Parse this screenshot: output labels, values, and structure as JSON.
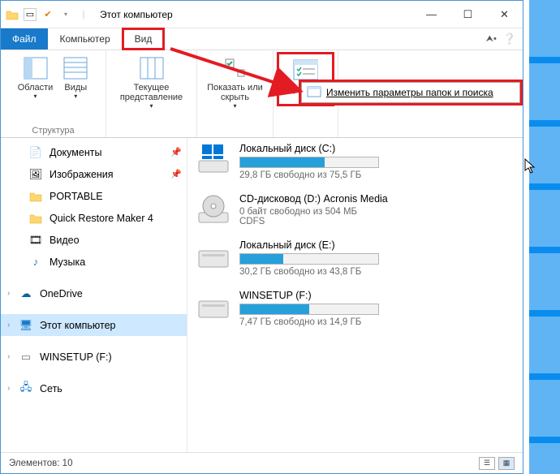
{
  "title": "Этот компьютер",
  "tabs": {
    "file": "Файл",
    "computer": "Компьютер",
    "view": "Вид"
  },
  "ribbon": {
    "panes": "Области",
    "views": "Виды",
    "struct": "Структура",
    "current": "Текущее представление",
    "show_hide": "Показать или скрыть",
    "params": "Параметры"
  },
  "dropdown": {
    "change_opts": "Изменить параметры папок и поиска"
  },
  "nav": {
    "documents": "Документы",
    "images": "Изображения",
    "portable": "PORTABLE",
    "qrm": "Quick Restore Maker 4",
    "video": "Видео",
    "music": "Музыка",
    "onedrive": "OneDrive",
    "thispc": "Этот компьютер",
    "winsetup": "WINSETUP (F:)",
    "network": "Сеть"
  },
  "drives": [
    {
      "name": "Локальный диск (C:)",
      "free": "29,8 ГБ свободно из 75,5 ГБ",
      "pct": 61,
      "type": "hdd"
    },
    {
      "name": "CD-дисковод (D:) Acronis Media",
      "free": "0 байт свободно из 504 МБ",
      "sub": "CDFS",
      "pct": 0,
      "type": "cd"
    },
    {
      "name": "Локальный диск (E:)",
      "free": "30,2 ГБ свободно из 43,8 ГБ",
      "pct": 31,
      "type": "hdd"
    },
    {
      "name": "WINSETUP (F:)",
      "free": "7,47 ГБ свободно из 14,9 ГБ",
      "pct": 50,
      "type": "hdd"
    }
  ],
  "status": {
    "elements": "Элементов: 10"
  }
}
